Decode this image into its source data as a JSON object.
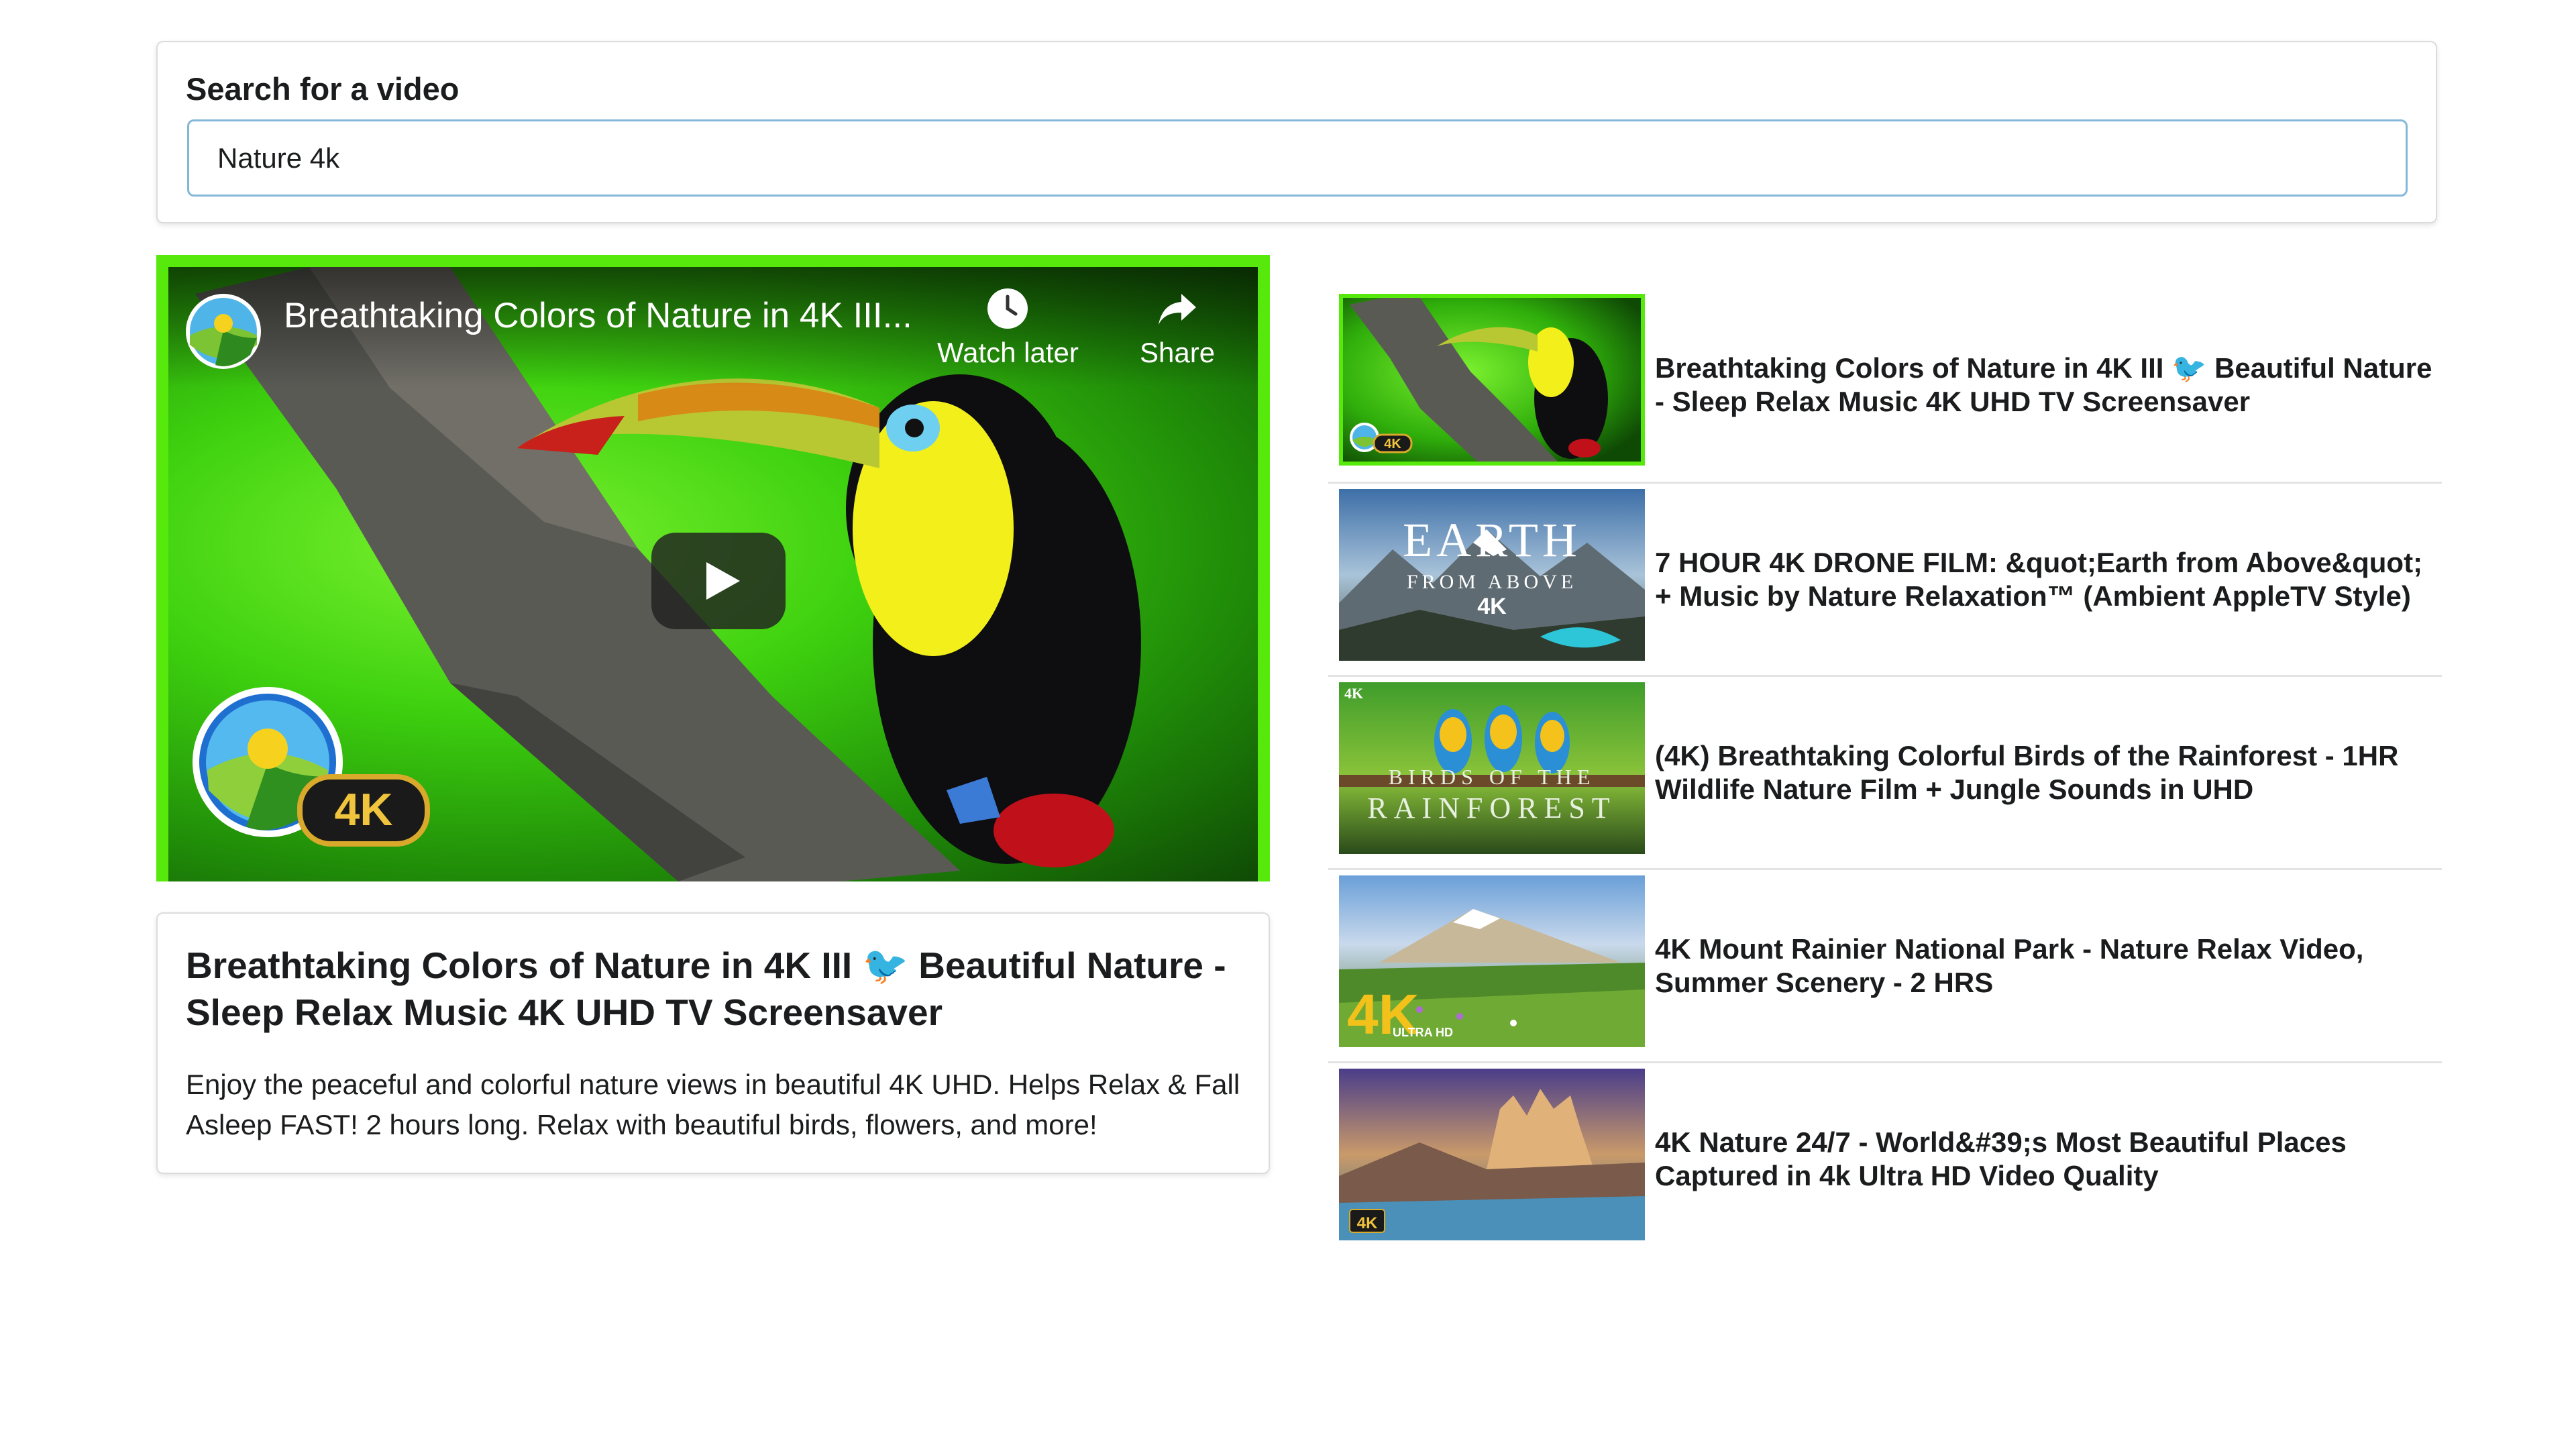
{
  "search": {
    "label": "Search for a video",
    "value": "Nature 4k",
    "input_border_color": "#85b7d9"
  },
  "player": {
    "title": "Breathtaking Colors of Nature in 4K III...",
    "watch_later": "Watch later",
    "share": "Share",
    "badge": "4K",
    "frame_color": "#57e80c"
  },
  "selected_video": {
    "title": "Breathtaking Colors of Nature in 4K III 🐦 Beautiful Nature - Sleep Relax Music 4K UHD TV Screensaver",
    "description": "Enjoy the peaceful and colorful nature views in beautiful 4K UHD. Helps Relax & Fall Asleep FAST! 2 hours long. Relax with beautiful birds, flowers, and more!"
  },
  "videos": [
    {
      "title": "Breathtaking Colors of Nature in 4K III 🐦 Beautiful Nature - Sleep Relax Music 4K UHD TV Screensaver",
      "thumb_badge": "4K"
    },
    {
      "title": "7 HOUR 4K DRONE FILM: &quot;Earth from Above&quot; + Music by Nature Relaxation™ (Ambient AppleTV Style)",
      "thumb_line1": "EARTH",
      "thumb_line2": "FROM ABOVE",
      "thumb_line3": "4K"
    },
    {
      "title": "(4K) Breathtaking Colorful Birds of the Rainforest - 1HR Wildlife Nature Film + Jungle Sounds in UHD",
      "thumb_corner": "4K",
      "thumb_line1": "BIRDS OF THE",
      "thumb_line2": "RAINFOREST"
    },
    {
      "title": "4K Mount Rainier National Park - Nature Relax Video, Summer Scenery - 2 HRS",
      "thumb_badge": "4K",
      "thumb_sub": "ULTRA HD"
    },
    {
      "title": "4K Nature 24/7 - World&#39;s Most Beautiful Places Captured in 4k Ultra HD Video Quality",
      "thumb_badge": "4K"
    }
  ]
}
